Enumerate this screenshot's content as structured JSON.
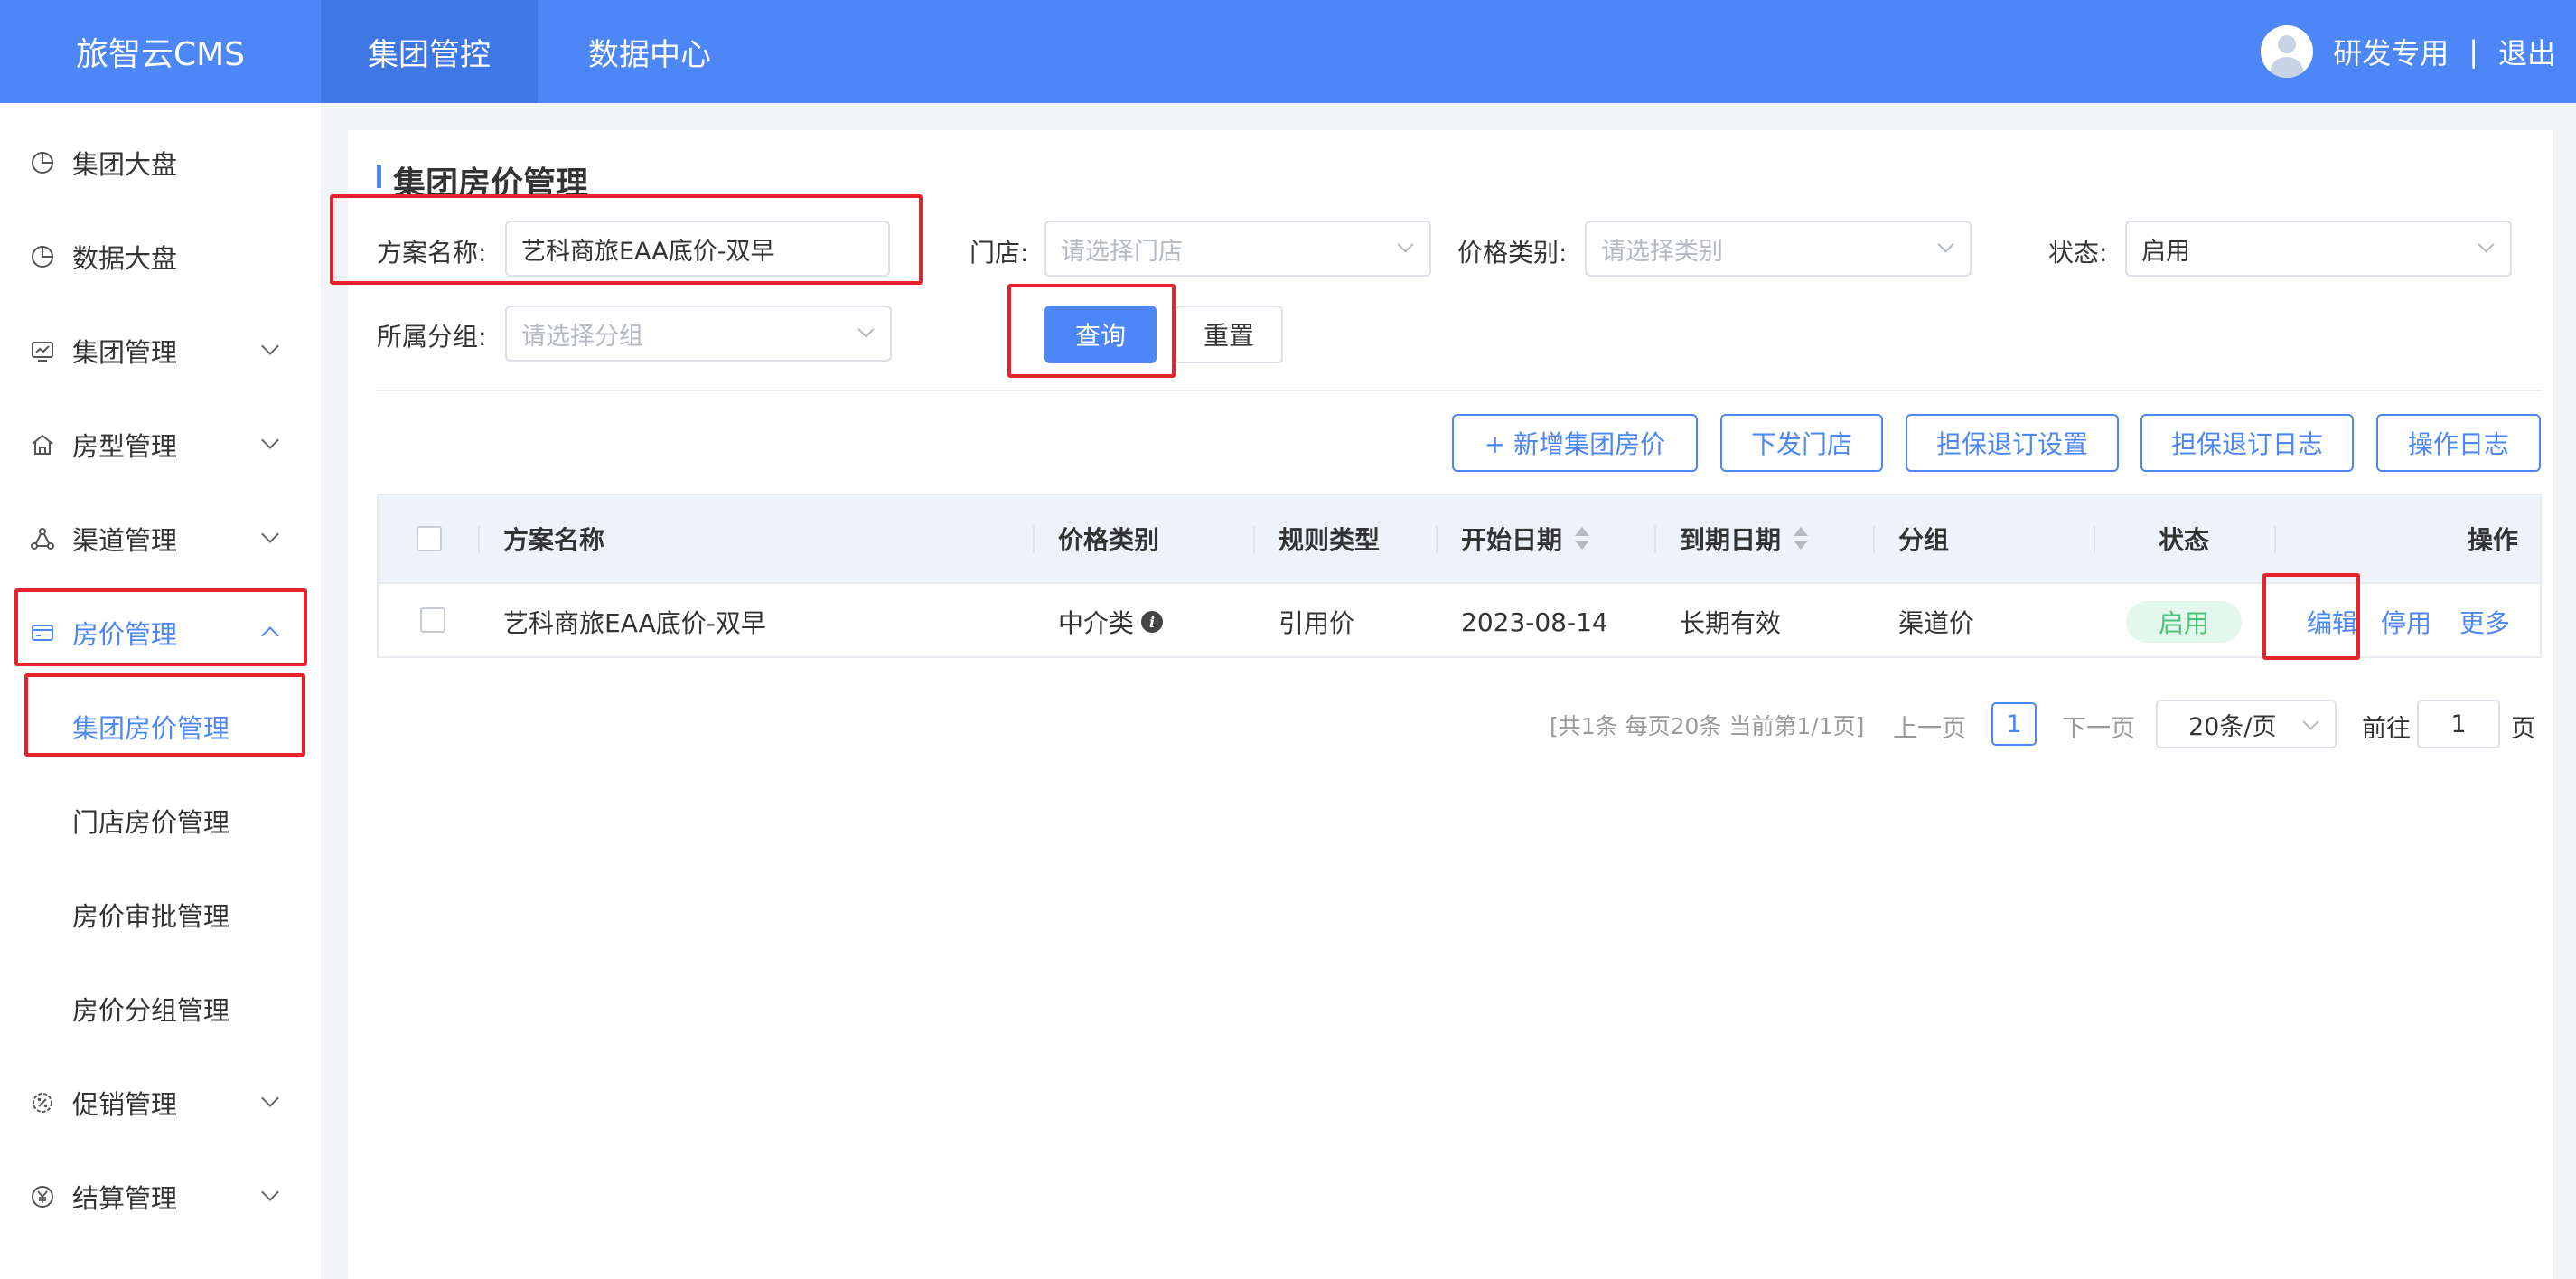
{
  "header": {
    "logo": "旅智云CMS",
    "nav": [
      "集团管控",
      "数据中心"
    ],
    "user_name": "研发专用",
    "separator": "|",
    "logout": "退出"
  },
  "sidebar": {
    "items": [
      {
        "label": "集团大盘",
        "icon": "pie-chart-icon"
      },
      {
        "label": "数据大盘",
        "icon": "pie-chart-icon"
      },
      {
        "label": "集团管理",
        "icon": "monitor-chart-icon"
      },
      {
        "label": "房型管理",
        "icon": "home-icon"
      },
      {
        "label": "渠道管理",
        "icon": "network-icon"
      },
      {
        "label": "房价管理",
        "icon": "card-icon"
      },
      {
        "label": "促销管理",
        "icon": "badge-icon"
      },
      {
        "label": "结算管理",
        "icon": "yen-icon"
      }
    ],
    "sub_items": [
      "集团房价管理",
      "门店房价管理",
      "房价审批管理",
      "房价分组管理"
    ]
  },
  "page": {
    "title": "集团房价管理"
  },
  "filters": {
    "plan_name_label": "方案名称:",
    "plan_name_value": "艺科商旅EAA底价-双早",
    "store_label": "门店:",
    "store_placeholder": "请选择门店",
    "price_type_label": "价格类别:",
    "price_type_placeholder": "请选择类别",
    "status_label": "状态:",
    "status_value": "启用",
    "group_label": "所属分组:",
    "group_placeholder": "请选择分组",
    "query_button": "查询",
    "reset_button": "重置"
  },
  "toolbar": {
    "add": "+ 新增集团房价",
    "dispatch": "下发门店",
    "guarantee_settings": "担保退订设置",
    "guarantee_log": "担保退订日志",
    "operation_log": "操作日志"
  },
  "table": {
    "columns": [
      "方案名称",
      "价格类别",
      "规则类型",
      "开始日期",
      "到期日期",
      "分组",
      "状态",
      "操作"
    ],
    "rows": [
      {
        "name": "艺科商旅EAA底价-双早",
        "price_type": "中介类",
        "rule_type": "引用价",
        "start_date": "2023-08-14",
        "end_date": "长期有效",
        "group": "渠道价",
        "status": "启用",
        "actions": [
          "编辑",
          "停用",
          "更多"
        ]
      }
    ]
  },
  "pagination": {
    "summary": "[共1条 每页20条 当前第1/1页]",
    "prev": "上一页",
    "current": "1",
    "next": "下一页",
    "page_size": "20条/页",
    "goto_label": "前往",
    "goto_value": "1",
    "goto_suffix": "页"
  },
  "colors": {
    "primary": "#4d86f6",
    "highlight": "#e8222a",
    "success": "#4cc37a"
  }
}
